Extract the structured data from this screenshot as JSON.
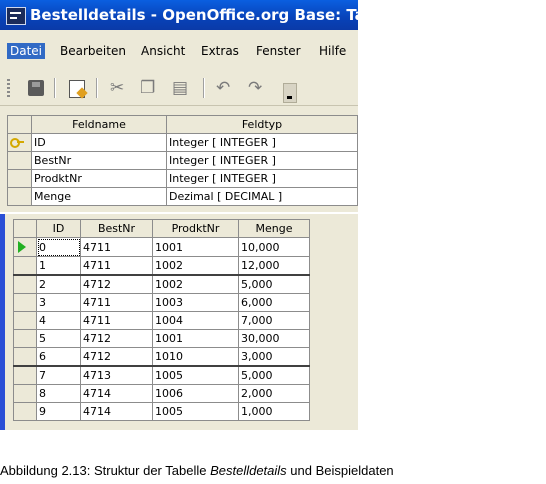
{
  "window": {
    "title": "Bestelldetails - OpenOffice.org Base: Tabe"
  },
  "menu": [
    "Datei",
    "Bearbeiten",
    "Ansicht",
    "Extras",
    "Fenster",
    "Hilfe"
  ],
  "design_table": {
    "headers": [
      "Feldname",
      "Feldtyp"
    ],
    "rows": [
      {
        "name": "ID",
        "type": "Integer [ INTEGER ]",
        "primary_key": true
      },
      {
        "name": "BestNr",
        "type": "Integer [ INTEGER ]"
      },
      {
        "name": "ProdktNr",
        "type": "Integer [ INTEGER ]"
      },
      {
        "name": "Menge",
        "type": "Dezimal [ DECIMAL ]"
      }
    ]
  },
  "data_table": {
    "headers": [
      "ID",
      "BestNr",
      "ProdktNr",
      "Menge"
    ],
    "rows": [
      [
        "0",
        "4711",
        "1001",
        "10,000"
      ],
      [
        "1",
        "4711",
        "1002",
        "12,000"
      ],
      [
        "2",
        "4712",
        "1002",
        "5,000"
      ],
      [
        "3",
        "4711",
        "1003",
        "6,000"
      ],
      [
        "4",
        "4711",
        "1004",
        "7,000"
      ],
      [
        "5",
        "4712",
        "1001",
        "30,000"
      ],
      [
        "6",
        "4712",
        "1010",
        "3,000"
      ],
      [
        "7",
        "4713",
        "1005",
        "5,000"
      ],
      [
        "8",
        "4714",
        "1006",
        "2,000"
      ],
      [
        "9",
        "4714",
        "1005",
        "1,000"
      ]
    ]
  },
  "caption": {
    "prefix": "Abbildung 2.13: Struktur der Tabelle ",
    "emphasis": "Bestelldetails",
    "suffix": " und Beispieldaten"
  },
  "icons": {
    "toolbar": [
      "save-icon",
      "edit-icon",
      "cut-icon",
      "copy-icon",
      "paste-icon",
      "undo-icon",
      "redo-icon",
      "dropdown-arrow-icon"
    ],
    "row_markers": [
      "primary-key-icon",
      "current-record-arrow-icon"
    ]
  },
  "colors": {
    "titlebar": "#0a5fe0",
    "menu_highlight": "#316ac5",
    "record_arrow": "#22b022"
  }
}
